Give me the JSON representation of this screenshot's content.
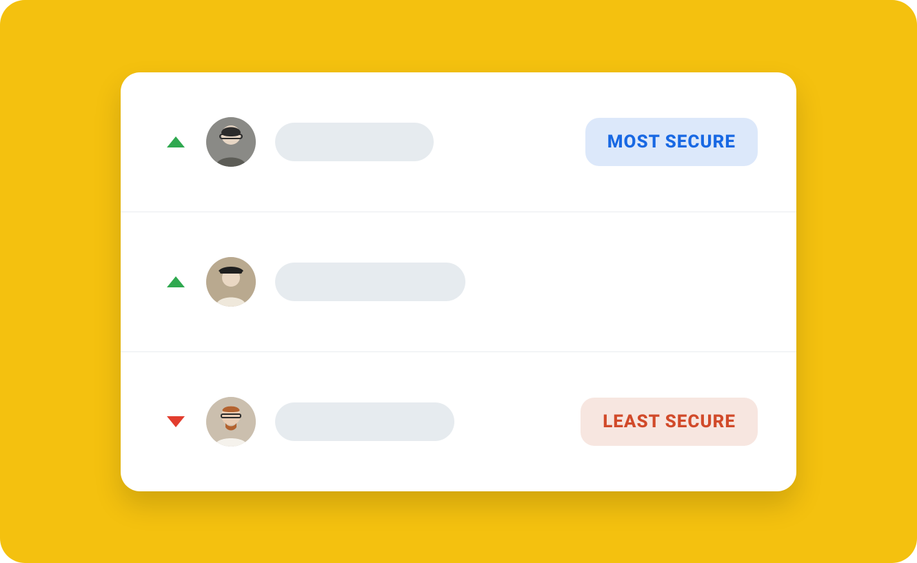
{
  "rows": [
    {
      "trend": "up",
      "badge": {
        "label": "MOST SECURE",
        "variant": "most"
      }
    },
    {
      "trend": "up",
      "badge": null
    },
    {
      "trend": "down",
      "badge": {
        "label": "LEAST SECURE",
        "variant": "least"
      }
    }
  ],
  "colors": {
    "trend_up": "#2FA84F",
    "trend_down": "#E23D2E",
    "badge_most_bg": "#DCE8FA",
    "badge_most_text": "#1868E3",
    "badge_least_bg": "#F7E6E0",
    "badge_least_text": "#D14A2A",
    "outer_bg": "#F4C10F"
  }
}
